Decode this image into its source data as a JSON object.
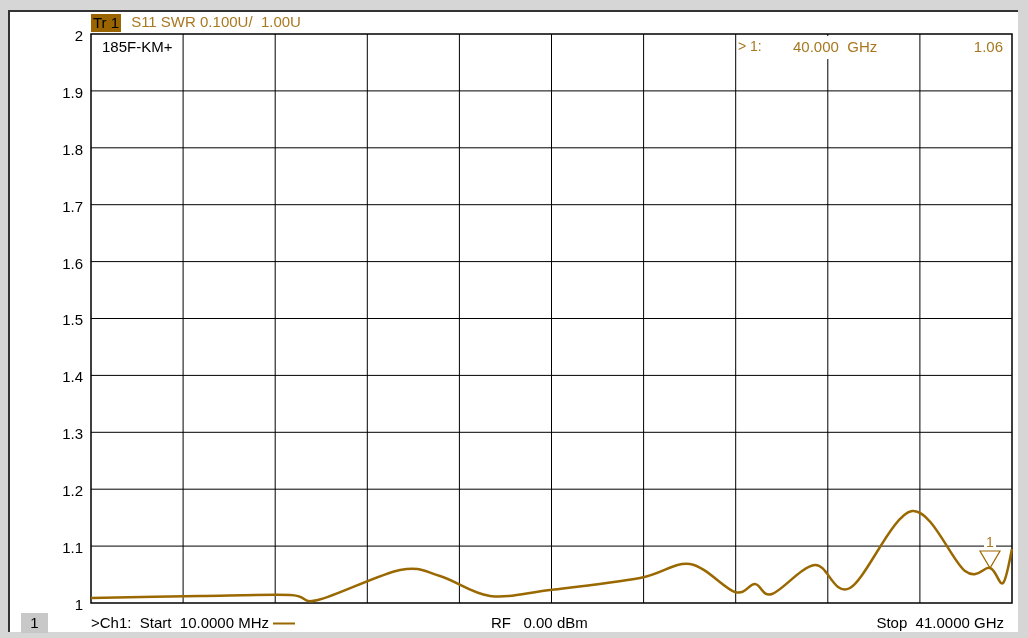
{
  "trace_header": {
    "trace": "Tr 1",
    "format": "S11 SWR 0.100U/  1.00U"
  },
  "chart": {
    "title_tag": "185F-KM+",
    "marker_readout": {
      "name": "> 1:",
      "stimulus": "40.000  GHz",
      "value": "1.06"
    },
    "marker": {
      "label": "1"
    },
    "y_axis_labels": [
      "2",
      "1.9",
      "1.8",
      "1.7",
      "1.6",
      "1.5",
      "1.4",
      "1.3",
      "1.2",
      "1.1",
      "1"
    ]
  },
  "status_bar": {
    "channel": "1",
    "start": ">Ch1:  Start  10.0000 MHz",
    "power": "RF   0.00 dBm",
    "stop": "Stop  41.0000 GHz"
  }
}
